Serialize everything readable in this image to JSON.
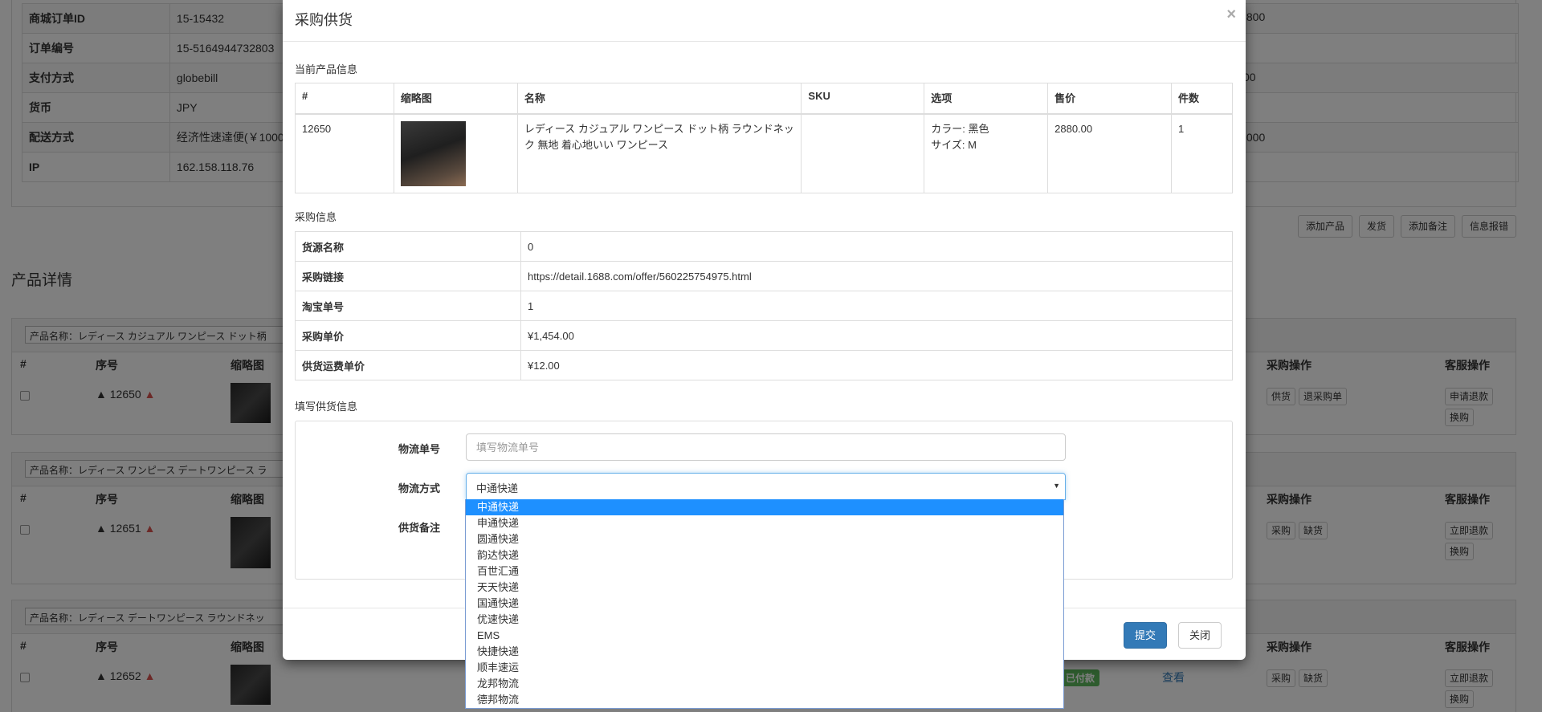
{
  "order_info": {
    "rows": [
      {
        "label": "商城订单ID",
        "value": "15-15432"
      },
      {
        "label": "订单编号",
        "value": "15-5164944732803"
      },
      {
        "label": "支付方式",
        "value": "globebill"
      },
      {
        "label": "货币",
        "value": "JPY"
      },
      {
        "label": "配送方式",
        "value": "经济性速達便(￥1000"
      },
      {
        "label": "IP",
        "value": "162.158.118.76"
      }
    ],
    "right_values": [
      ",800",
      "00",
      ",000"
    ]
  },
  "order_actions": [
    "添加产品",
    "发货",
    "添加备注",
    "信息报错"
  ],
  "section_title": "产品详情",
  "product_panels": [
    {
      "name": "产品名称：レディース カジュアル ワンピース ドット柄",
      "headers": {
        "hash": "#",
        "seq": "序号",
        "thumb": "缩略图",
        "buy_ops": "采购操作",
        "cs_ops": "客服操作"
      },
      "seq": "12650",
      "buy_ops": [
        "供货",
        "退采购单"
      ],
      "cs_ops": [
        "申请退款",
        "换购"
      ]
    },
    {
      "name": "产品名称：レディース ワンピース デートワンピース ラ",
      "headers": {
        "hash": "#",
        "seq": "序号",
        "thumb": "缩略图",
        "buy_ops": "采购操作",
        "cs_ops": "客服操作"
      },
      "seq": "12651",
      "buy_ops": [
        "采购",
        "缺货"
      ],
      "cs_ops": [
        "立即退款",
        "换购"
      ]
    },
    {
      "name": "产品名称：レディース デートワンピース ラウンドネッ",
      "headers": {
        "hash": "#",
        "seq": "序号",
        "thumb": "缩略图",
        "buy_ops": "采购操作",
        "cs_ops": "客服操作"
      },
      "seq": "12652",
      "paid": "已付款",
      "view": "查看",
      "buy_ops": [
        "采购",
        "缺货"
      ],
      "cs_ops": [
        "立即退款",
        "换购"
      ]
    }
  ],
  "modal": {
    "title": "采购供货",
    "close": "×",
    "current_product_title": "当前产品信息",
    "product_table": {
      "headers": [
        "#",
        "缩略图",
        "名称",
        "SKU",
        "选项",
        "售价",
        "件数"
      ],
      "row": {
        "id": "12650",
        "name": "レディース カジュアル ワンピース ドット柄 ラウンドネック 無地 着心地いい ワンピース",
        "sku": "",
        "option_color": "カラー: 黑色",
        "option_size": "サイズ: M",
        "price": "2880.00",
        "qty": "1"
      }
    },
    "purchase_info_title": "采购信息",
    "purchase_rows": [
      {
        "label": "货源名称",
        "value": "0"
      },
      {
        "label": "采购链接",
        "value": "https://detail.1688.com/offer/560225754975.html"
      },
      {
        "label": "淘宝单号",
        "value": "1"
      },
      {
        "label": "采购单价",
        "value": "¥1,454.00"
      },
      {
        "label": "供货运费单价",
        "value": "¥12.00"
      }
    ],
    "supply_form_title": "填写供货信息",
    "form": {
      "tracking_label": "物流单号",
      "tracking_placeholder": "填写物流单号",
      "shipping_label": "物流方式",
      "shipping_selected": "中通快递",
      "remark_label": "供货备注"
    },
    "submit": "提交",
    "cancel": "关闭"
  },
  "shipping_options": [
    "中通快递",
    "申通快递",
    "圆通快递",
    "韵达快递",
    "百世汇通",
    "天天快递",
    "国通快递",
    "优速快递",
    "EMS",
    "快捷快递",
    "顺丰速运",
    "龙邦物流",
    "德邦物流"
  ],
  "colors": {
    "primary": "#337ab7",
    "selected_option": "#1e90ff",
    "paid": "#5cb85c",
    "warning": "#d9534f"
  }
}
